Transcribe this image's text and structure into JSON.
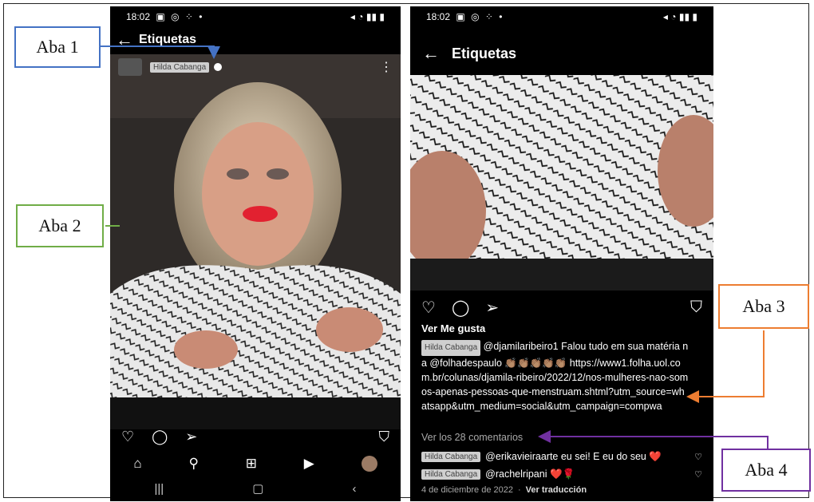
{
  "left_phone": {
    "status_time": "18:02",
    "header_title": "Etiquetas",
    "username": "Hilda Cabanga",
    "nav": [
      "home-icon",
      "search-icon",
      "new-post-icon",
      "reels-icon",
      "profile-avatar"
    ]
  },
  "right_phone": {
    "status_time": "18:02",
    "header_title": "Etiquetas",
    "likes_label": "Ver Me gusta",
    "caption_user": "Hilda Cabanga",
    "caption_text": "@djamilaribeiro1 Falou tudo em sua matéria na @folhadespaulo 👏🏽👏🏽👏🏽👏🏽👏🏽",
    "caption_link": "https://www1.folha.uol.com.br/colunas/djamila-ribeiro/2022/12/nos-mulheres-nao-somos-apenas-pessoas-que-menstruam.shtml?utm_source=whatsapp&utm_medium=social&utm_campaign=compwa",
    "comments_link": "Ver los 28 comentarios",
    "comments": [
      {
        "user": "Hilda Cabanga",
        "text": "@erikavieiraarte eu sei! E eu do seu ❤️"
      },
      {
        "user": "Hilda Cabanga",
        "text": "@rachelripani ❤️🌹"
      }
    ],
    "date": "4 de diciembre de 2022",
    "translate": "Ver traducción"
  },
  "annotations": {
    "aba1": "Aba 1",
    "aba2": "Aba 2",
    "aba3": "Aba 3",
    "aba4": "Aba 4"
  },
  "colors": {
    "aba1": "#4472c4",
    "aba2": "#70ad47",
    "aba3": "#ed7d31",
    "aba4": "#7030a0"
  }
}
